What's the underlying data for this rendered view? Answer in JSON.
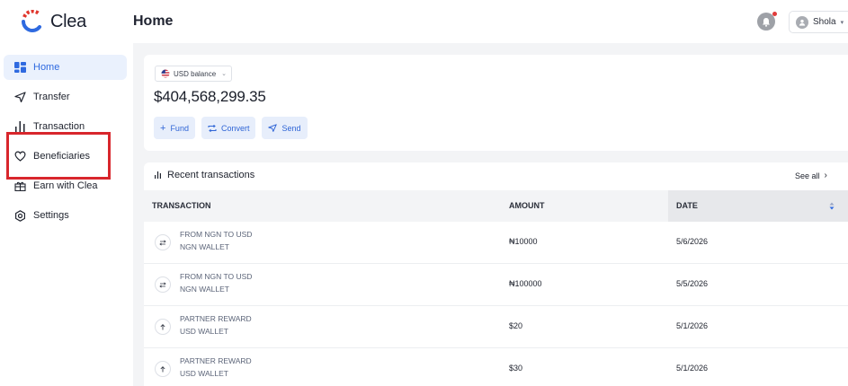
{
  "brand": {
    "name": "Clea",
    "accent": "#2f6ae0",
    "logo_red": "#e0362c",
    "logo_blue": "#2f6ae0"
  },
  "sidebar": {
    "items": [
      {
        "label": "Home",
        "icon": "home-grid-icon",
        "active": true
      },
      {
        "label": "Transfer",
        "icon": "send-icon",
        "active": false
      },
      {
        "label": "Transaction",
        "icon": "bar-chart-icon",
        "active": false
      },
      {
        "label": "Beneficiaries",
        "icon": "heart-icon",
        "active": false
      },
      {
        "label": "Earn with Clea",
        "icon": "gift-icon",
        "active": false
      },
      {
        "label": "Settings",
        "icon": "gear-icon",
        "active": false
      }
    ]
  },
  "header": {
    "title": "Home",
    "user": {
      "name": "Shola"
    }
  },
  "balance": {
    "selector_label": "USD balance",
    "currency_flag": "us-flag-icon",
    "amount": "$404,568,299.35",
    "actions": [
      {
        "label": "Fund",
        "icon": "plus-icon"
      },
      {
        "label": "Convert",
        "icon": "convert-icon"
      },
      {
        "label": "Send",
        "icon": "send-icon"
      }
    ]
  },
  "transactions": {
    "title": "Recent transactions",
    "see_all": "See all",
    "columns": {
      "transaction": "TRANSACTION",
      "amount": "AMOUNT",
      "date": "DATE"
    },
    "rows": [
      {
        "icon": "swap-icon",
        "title": "FROM NGN TO USD",
        "wallet": "NGN WALLET",
        "amount": "₦10000",
        "date": "5/6/2026"
      },
      {
        "icon": "swap-icon",
        "title": "FROM NGN TO USD",
        "wallet": "NGN WALLET",
        "amount": "₦100000",
        "date": "5/5/2026"
      },
      {
        "icon": "arrow-up-icon",
        "title": "PARTNER REWARD",
        "wallet": "USD WALLET",
        "amount": "$20",
        "date": "5/1/2026"
      },
      {
        "icon": "arrow-up-icon",
        "title": "PARTNER REWARD",
        "wallet": "USD WALLET",
        "amount": "$30",
        "date": "5/1/2026"
      }
    ]
  }
}
